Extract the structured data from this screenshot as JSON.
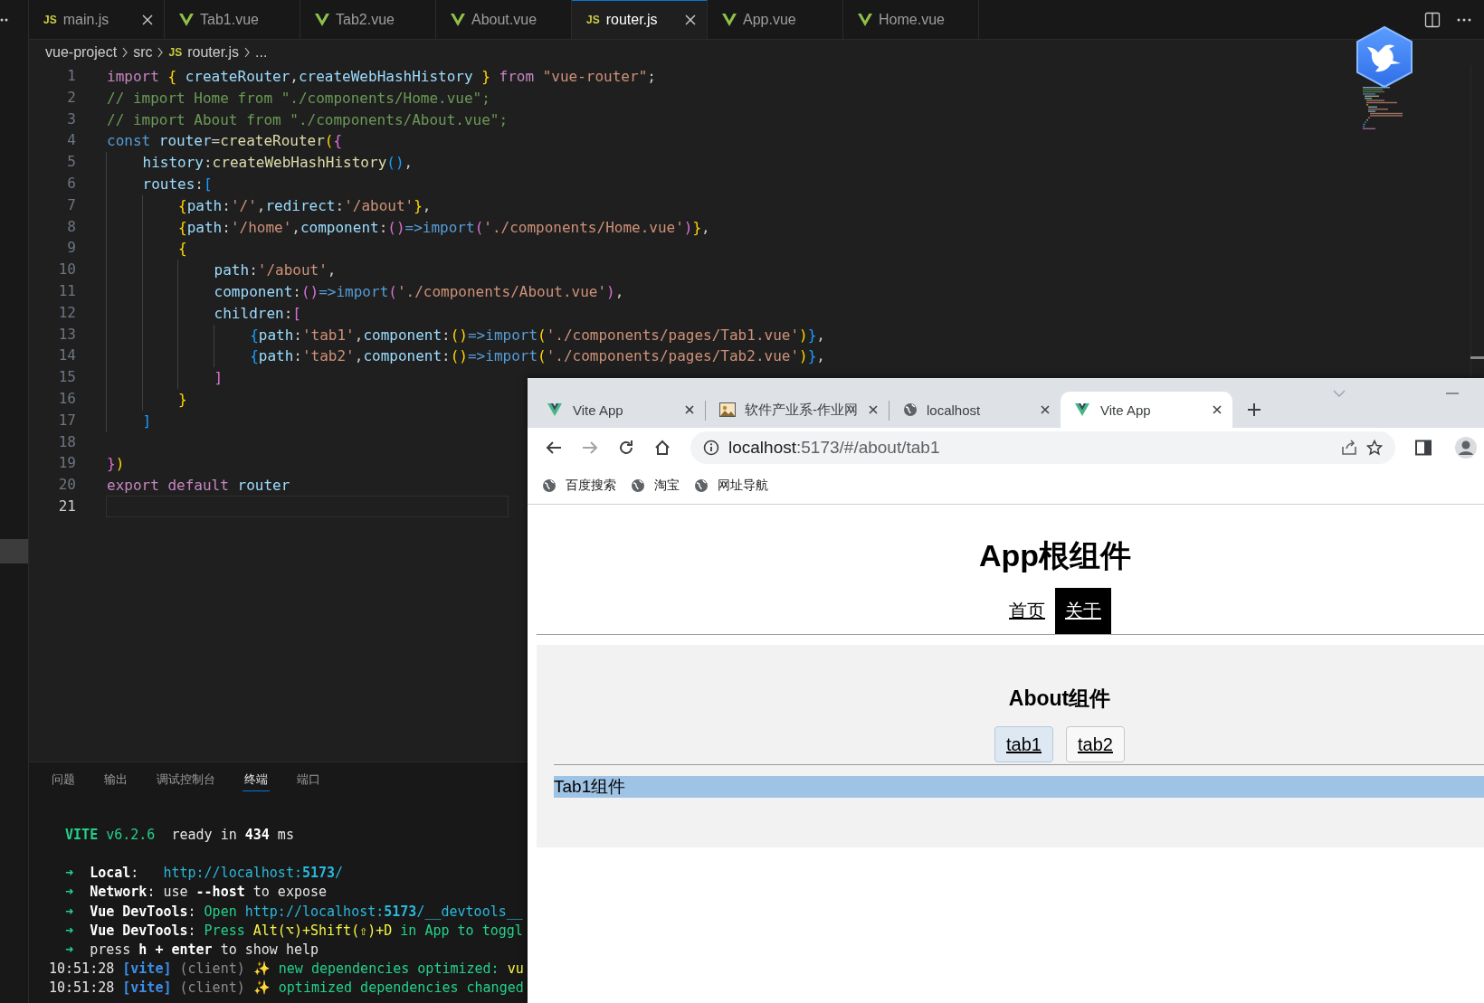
{
  "editor": {
    "tabs": [
      {
        "label": "main.js",
        "kind": "js",
        "badge": "JS",
        "selected": false,
        "closable": true
      },
      {
        "label": "Tab1.vue",
        "kind": "vue",
        "selected": false,
        "closable": false
      },
      {
        "label": "Tab2.vue",
        "kind": "vue",
        "selected": false,
        "closable": false
      },
      {
        "label": "About.vue",
        "kind": "vue",
        "selected": false,
        "closable": false
      },
      {
        "label": "router.js",
        "kind": "js",
        "badge": "JS",
        "selected": true,
        "closable": true
      },
      {
        "label": "App.vue",
        "kind": "vue",
        "selected": false,
        "closable": false
      },
      {
        "label": "Home.vue",
        "kind": "vue",
        "selected": false,
        "closable": false
      }
    ],
    "breadcrumb": [
      {
        "label": "vue-project",
        "kind": "folder"
      },
      {
        "label": "src",
        "kind": "folder"
      },
      {
        "label": "router.js",
        "kind": "js",
        "badge": "JS"
      },
      {
        "label": "...",
        "kind": "more"
      }
    ],
    "lines": [
      {
        "number": "1",
        "current": false,
        "tokens": [
          {
            "text": "import ",
            "kind": "kw"
          },
          {
            "text": "{ ",
            "kind": "y"
          },
          {
            "text": "createRouter",
            "kind": "va"
          },
          {
            "text": ",",
            "kind": "p"
          },
          {
            "text": "createWebHashHistory ",
            "kind": "va"
          },
          {
            "text": "} ",
            "kind": "y"
          },
          {
            "text": "from ",
            "kind": "kw"
          },
          {
            "text": "\"vue-router\"",
            "kind": "s"
          },
          {
            "text": ";",
            "kind": "p"
          }
        ]
      },
      {
        "number": "2",
        "current": false,
        "tokens": [
          {
            "text": "// import Home from \"./components/Home.vue\";",
            "kind": "c"
          }
        ]
      },
      {
        "number": "3",
        "current": false,
        "tokens": [
          {
            "text": "// import About from \"./components/About.vue\";",
            "kind": "c"
          }
        ]
      },
      {
        "number": "4",
        "current": false,
        "tokens": [
          {
            "text": "const ",
            "kind": "st"
          },
          {
            "text": "router",
            "kind": "va"
          },
          {
            "text": "=",
            "kind": "p"
          },
          {
            "text": "createRouter",
            "kind": "fn"
          },
          {
            "text": "(",
            "kind": "y"
          },
          {
            "text": "{",
            "kind": "m"
          }
        ]
      },
      {
        "number": "5",
        "current": false,
        "tokens": [
          {
            "text": "    history",
            "kind": "va"
          },
          {
            "text": ":",
            "kind": "p"
          },
          {
            "text": "createWebHashHistory",
            "kind": "fn"
          },
          {
            "text": "()",
            "kind": "b"
          },
          {
            "text": ",",
            "kind": "p"
          }
        ]
      },
      {
        "number": "6",
        "current": false,
        "tokens": [
          {
            "text": "    routes",
            "kind": "va"
          },
          {
            "text": ":",
            "kind": "p"
          },
          {
            "text": "[",
            "kind": "b"
          }
        ]
      },
      {
        "number": "7",
        "current": false,
        "tokens": [
          {
            "text": "        {",
            "kind": "y"
          },
          {
            "text": "path",
            "kind": "va"
          },
          {
            "text": ":",
            "kind": "p"
          },
          {
            "text": "'/'",
            "kind": "s"
          },
          {
            "text": ",",
            "kind": "p"
          },
          {
            "text": "redirect",
            "kind": "va"
          },
          {
            "text": ":",
            "kind": "p"
          },
          {
            "text": "'/about'",
            "kind": "s"
          },
          {
            "text": "}",
            "kind": "y"
          },
          {
            "text": ",",
            "kind": "p"
          }
        ]
      },
      {
        "number": "8",
        "current": false,
        "tokens": [
          {
            "text": "        {",
            "kind": "y"
          },
          {
            "text": "path",
            "kind": "va"
          },
          {
            "text": ":",
            "kind": "p"
          },
          {
            "text": "'/home'",
            "kind": "s"
          },
          {
            "text": ",",
            "kind": "p"
          },
          {
            "text": "component",
            "kind": "va"
          },
          {
            "text": ":",
            "kind": "p"
          },
          {
            "text": "()",
            "kind": "m"
          },
          {
            "text": "=>import",
            "kind": "st"
          },
          {
            "text": "(",
            "kind": "m"
          },
          {
            "text": "'./components/Home.vue'",
            "kind": "s"
          },
          {
            "text": ")",
            "kind": "m"
          },
          {
            "text": "}",
            "kind": "y"
          },
          {
            "text": ",",
            "kind": "p"
          }
        ]
      },
      {
        "number": "9",
        "current": false,
        "tokens": [
          {
            "text": "        {",
            "kind": "y"
          }
        ]
      },
      {
        "number": "10",
        "current": false,
        "tokens": [
          {
            "text": "            path",
            "kind": "va"
          },
          {
            "text": ":",
            "kind": "p"
          },
          {
            "text": "'/about'",
            "kind": "s"
          },
          {
            "text": ",",
            "kind": "p"
          }
        ]
      },
      {
        "number": "11",
        "current": false,
        "tokens": [
          {
            "text": "            component",
            "kind": "va"
          },
          {
            "text": ":",
            "kind": "p"
          },
          {
            "text": "()",
            "kind": "m"
          },
          {
            "text": "=>import",
            "kind": "st"
          },
          {
            "text": "(",
            "kind": "m"
          },
          {
            "text": "'./components/About.vue'",
            "kind": "s"
          },
          {
            "text": ")",
            "kind": "m"
          },
          {
            "text": ",",
            "kind": "p"
          }
        ]
      },
      {
        "number": "12",
        "current": false,
        "tokens": [
          {
            "text": "            children",
            "kind": "va"
          },
          {
            "text": ":",
            "kind": "p"
          },
          {
            "text": "[",
            "kind": "m"
          }
        ]
      },
      {
        "number": "13",
        "current": false,
        "tokens": [
          {
            "text": "                {",
            "kind": "b"
          },
          {
            "text": "path",
            "kind": "va"
          },
          {
            "text": ":",
            "kind": "p"
          },
          {
            "text": "'tab1'",
            "kind": "s"
          },
          {
            "text": ",",
            "kind": "p"
          },
          {
            "text": "component",
            "kind": "va"
          },
          {
            "text": ":",
            "kind": "p"
          },
          {
            "text": "()",
            "kind": "y"
          },
          {
            "text": "=>import",
            "kind": "st"
          },
          {
            "text": "(",
            "kind": "y"
          },
          {
            "text": "'./components/pages/Tab1.vue'",
            "kind": "s"
          },
          {
            "text": ")",
            "kind": "y"
          },
          {
            "text": "}",
            "kind": "b"
          },
          {
            "text": ",",
            "kind": "p"
          }
        ]
      },
      {
        "number": "14",
        "current": false,
        "tokens": [
          {
            "text": "                {",
            "kind": "b"
          },
          {
            "text": "path",
            "kind": "va"
          },
          {
            "text": ":",
            "kind": "p"
          },
          {
            "text": "'tab2'",
            "kind": "s"
          },
          {
            "text": ",",
            "kind": "p"
          },
          {
            "text": "component",
            "kind": "va"
          },
          {
            "text": ":",
            "kind": "p"
          },
          {
            "text": "()",
            "kind": "y"
          },
          {
            "text": "=>import",
            "kind": "st"
          },
          {
            "text": "(",
            "kind": "y"
          },
          {
            "text": "'./components/pages/Tab2.vue'",
            "kind": "s"
          },
          {
            "text": ")",
            "kind": "y"
          },
          {
            "text": "}",
            "kind": "b"
          },
          {
            "text": ",",
            "kind": "p"
          }
        ]
      },
      {
        "number": "15",
        "current": false,
        "tokens": [
          {
            "text": "            ]",
            "kind": "m"
          }
        ]
      },
      {
        "number": "16",
        "current": false,
        "tokens": [
          {
            "text": "        }",
            "kind": "y"
          }
        ]
      },
      {
        "number": "17",
        "current": false,
        "tokens": [
          {
            "text": "    ]",
            "kind": "b"
          }
        ]
      },
      {
        "number": "18",
        "current": false
      },
      {
        "number": "19",
        "current": false,
        "tokens": [
          {
            "text": "}",
            "kind": "m"
          },
          {
            "text": ")",
            "kind": "y"
          }
        ]
      },
      {
        "number": "20",
        "current": false,
        "tokens": [
          {
            "text": "export default ",
            "kind": "kw"
          },
          {
            "text": "router",
            "kind": "va"
          }
        ]
      },
      {
        "number": "21",
        "current": true
      }
    ]
  },
  "panel": {
    "tabs": [
      {
        "label": "问题",
        "selected": false
      },
      {
        "label": "输出",
        "selected": false
      },
      {
        "label": "调试控制台",
        "selected": false
      },
      {
        "label": "终端",
        "selected": true
      },
      {
        "label": "端口",
        "selected": false
      }
    ],
    "terminal": [
      {
        "lines": [
          {
            "tokens": [
              {
                "text": "  VITE",
                "kind": "gb"
              },
              {
                "text": " v6.2.6",
                "kind": "g"
              },
              {
                "text": "  ready in ",
                "kind": "w"
              },
              {
                "text": "434",
                "kind": "wb"
              },
              {
                "text": " ms",
                "kind": "w"
              }
            ]
          }
        ]
      },
      {
        "lines": [
          {
            "tokens": [
              {
                "text": "  ➜  ",
                "kind": "g"
              },
              {
                "text": "Local",
                "kind": "wb"
              },
              {
                "text": ":   ",
                "kind": "w"
              },
              {
                "text": "http://localhost:",
                "kind": "l"
              },
              {
                "text": "5173",
                "kind": "lb"
              },
              {
                "text": "/",
                "kind": "l"
              }
            ]
          },
          {
            "tokens": [
              {
                "text": "  ➜  ",
                "kind": "g"
              },
              {
                "text": "Network",
                "kind": "wb"
              },
              {
                "text": ": use ",
                "kind": "w"
              },
              {
                "text": "--host",
                "kind": "wb"
              },
              {
                "text": " to expose",
                "kind": "w"
              }
            ]
          },
          {
            "tokens": [
              {
                "text": "  ➜  ",
                "kind": "g"
              },
              {
                "text": "Vue DevTools",
                "kind": "wb"
              },
              {
                "text": ": ",
                "kind": "w"
              },
              {
                "text": "Open ",
                "kind": "g"
              },
              {
                "text": "http://localhost:",
                "kind": "l"
              },
              {
                "text": "5173",
                "kind": "lb"
              },
              {
                "text": "/__devtools__",
                "kind": "l"
              }
            ]
          },
          {
            "tokens": [
              {
                "text": "  ➜  ",
                "kind": "g"
              },
              {
                "text": "Vue DevTools",
                "kind": "wb"
              },
              {
                "text": ": ",
                "kind": "w"
              },
              {
                "text": "Press ",
                "kind": "g"
              },
              {
                "text": "Alt(⌥)+Shift(⇧)+D",
                "kind": "y"
              },
              {
                "text": " in App to toggl",
                "kind": "g"
              }
            ]
          },
          {
            "tokens": [
              {
                "text": "  ➜  ",
                "kind": "g"
              },
              {
                "text": "press ",
                "kind": "w"
              },
              {
                "text": "h + enter",
                "kind": "wb"
              },
              {
                "text": " to show help",
                "kind": "w"
              }
            ]
          },
          {
            "tokens": [
              {
                "text": "10:51:28 ",
                "kind": "w"
              },
              {
                "text": "[vite]",
                "kind": "vb"
              },
              {
                "text": " (client) ",
                "kind": "gr"
              },
              {
                "text": "✨ ",
                "kind": "sp"
              },
              {
                "text": "new dependencies optimized: ",
                "kind": "g"
              },
              {
                "text": "vu",
                "kind": "y"
              }
            ]
          },
          {
            "tokens": [
              {
                "text": "10:51:28 ",
                "kind": "w"
              },
              {
                "text": "[vite]",
                "kind": "vb"
              },
              {
                "text": " (client) ",
                "kind": "gr"
              },
              {
                "text": "✨ ",
                "kind": "sp"
              },
              {
                "text": "optimized dependencies changed",
                "kind": "g"
              }
            ]
          }
        ]
      }
    ]
  },
  "browser": {
    "tabs": [
      {
        "title": "Vite App",
        "kind": "vue",
        "selected": false
      },
      {
        "title": "软件产业系-作业网",
        "kind": "picture",
        "selected": false
      },
      {
        "title": "localhost",
        "kind": "globe",
        "selected": false
      },
      {
        "title": "Vite App",
        "kind": "vue",
        "selected": true
      }
    ],
    "address": {
      "host": "localhost",
      "path": ":5173/#/about/tab1"
    },
    "bookmarks": [
      {
        "label": "百度搜索"
      },
      {
        "label": "淘宝"
      },
      {
        "label": "网址导航"
      }
    ],
    "page": {
      "title": "App根组件",
      "nav": [
        {
          "label": "首页",
          "selected": false
        },
        {
          "label": "关于",
          "selected": true
        }
      ],
      "section_title": "About组件",
      "section_tabs": [
        {
          "label": "tab1",
          "selected": true
        },
        {
          "label": "tab2",
          "selected": false
        }
      ],
      "content": "Tab1组件"
    }
  }
}
